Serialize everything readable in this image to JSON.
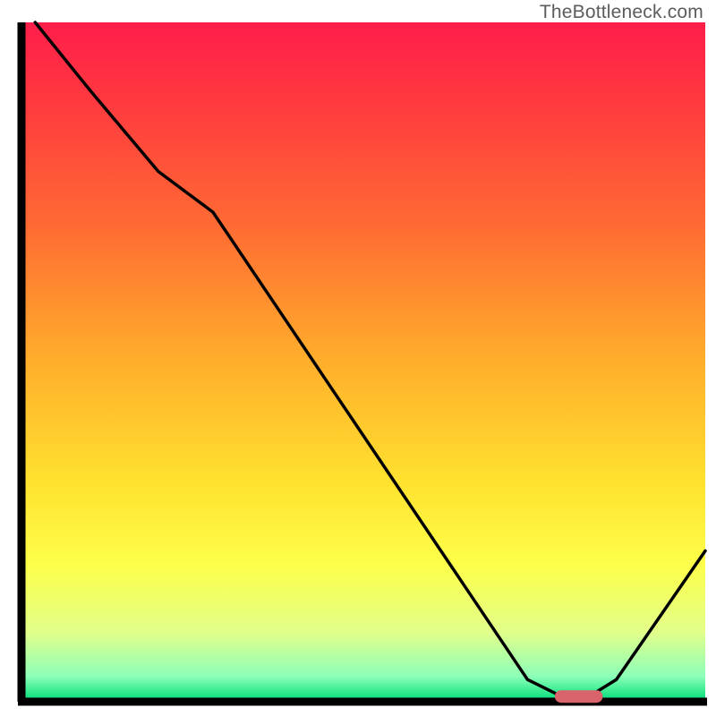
{
  "attribution": "TheBottleneck.com",
  "chart_data": {
    "type": "line",
    "title": "",
    "xlabel": "",
    "ylabel": "",
    "xlim": [
      0,
      100
    ],
    "ylim": [
      0,
      100
    ],
    "series": [
      {
        "name": "bottleneck-curve",
        "x": [
          2,
          10,
          20,
          28,
          40,
          52,
          64,
          74,
          79,
          83,
          87,
          100
        ],
        "y": [
          100,
          90,
          78,
          72,
          54,
          36,
          18,
          3,
          0.5,
          0.5,
          3,
          22
        ]
      }
    ],
    "marker": {
      "name": "optimal-zone",
      "x_start": 78,
      "x_end": 85,
      "y": 0.5,
      "color": "#d9646c"
    },
    "gradient_stops": [
      {
        "offset": 0.0,
        "color": "#ff1e4a"
      },
      {
        "offset": 0.12,
        "color": "#ff3a3f"
      },
      {
        "offset": 0.3,
        "color": "#ff6b33"
      },
      {
        "offset": 0.5,
        "color": "#ffae2b"
      },
      {
        "offset": 0.68,
        "color": "#ffe22f"
      },
      {
        "offset": 0.8,
        "color": "#fdff4a"
      },
      {
        "offset": 0.9,
        "color": "#e2ff8a"
      },
      {
        "offset": 0.965,
        "color": "#8dffb9"
      },
      {
        "offset": 1.0,
        "color": "#05e07a"
      }
    ]
  }
}
